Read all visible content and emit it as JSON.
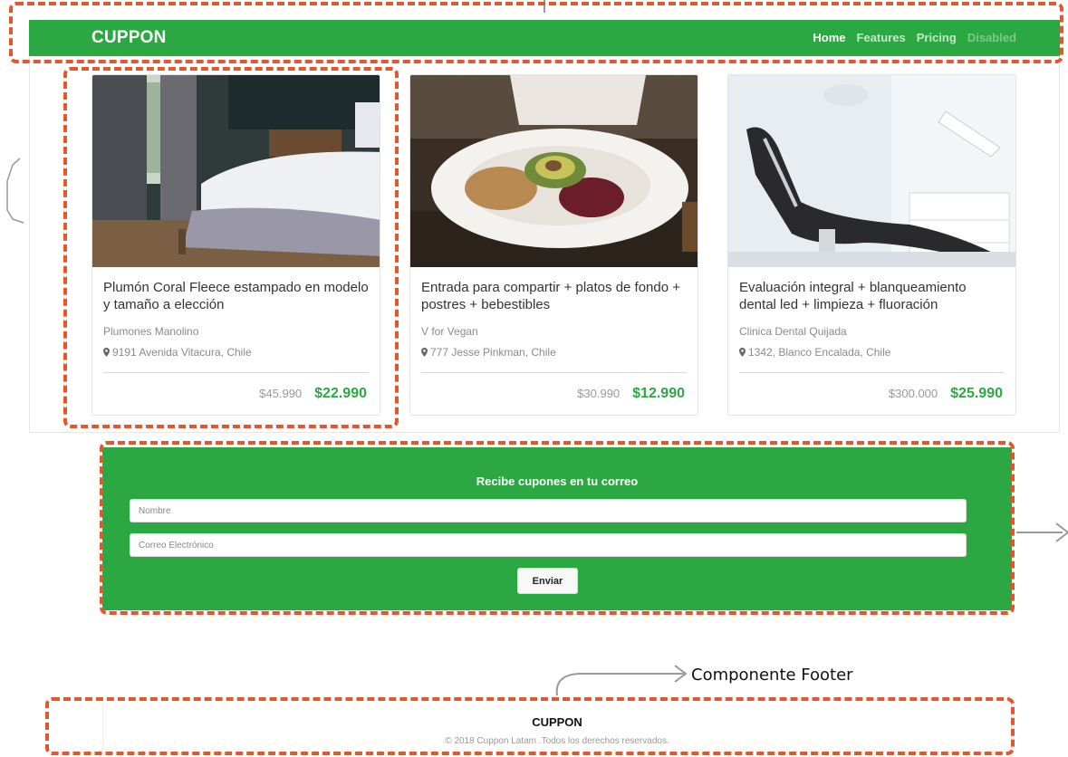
{
  "navbar": {
    "brand": "CUPPON",
    "links": [
      {
        "label": "Home"
      },
      {
        "label": "Features"
      },
      {
        "label": "Pricing"
      },
      {
        "label": "Disabled"
      }
    ]
  },
  "cards": [
    {
      "title": "Plumón Coral Fleece estampado en modelo y tamaño a elección",
      "vendor": "Plumones Manolino",
      "address": "9191 Avenida Vitacura, Chile",
      "old_price": "$45.990",
      "new_price": "$22.990"
    },
    {
      "title": "Entrada para compartir + platos de fondo + postres + bebestibles",
      "vendor": "V for Vegan",
      "address": "777 Jesse Pinkman, Chile",
      "old_price": "$30.990",
      "new_price": "$12.990"
    },
    {
      "title": "Evaluación integral + blanqueamiento dental led + limpieza + fluoración",
      "vendor": "Clinica Dental Quijada",
      "address": "1342, Blanco Encalada, Chile",
      "old_price": "$300.000",
      "new_price": "$25.990"
    }
  ],
  "newsletter": {
    "title": "Recibe cupones en tu correo",
    "name_placeholder": "Nombre",
    "email_placeholder": "Correo Electrónico",
    "submit_label": "Enviar"
  },
  "annotation": {
    "footer_label": "Componente Footer"
  },
  "footer": {
    "brand": "CUPPON",
    "copyright": "© 2018 Cuppon Latam .Todos los derechos reservados."
  },
  "colors": {
    "primary_green": "#2ca842",
    "annotation_orange": "#e4572e"
  }
}
